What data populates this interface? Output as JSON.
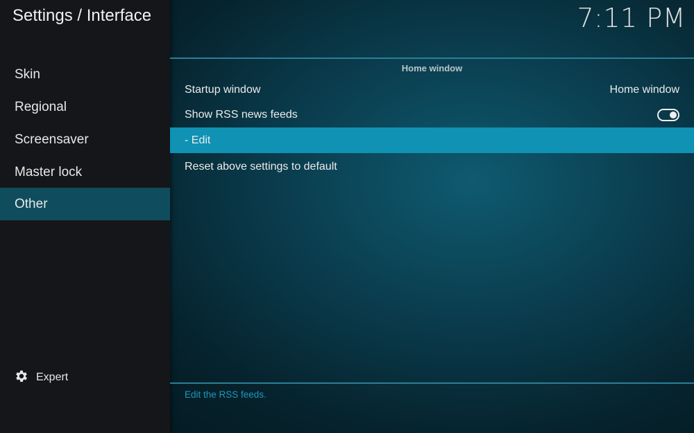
{
  "header": {
    "title": "Settings / Interface"
  },
  "clock": "7:11 PM",
  "sidebar": {
    "items": [
      {
        "label": "Skin"
      },
      {
        "label": "Regional"
      },
      {
        "label": "Screensaver"
      },
      {
        "label": "Master lock"
      },
      {
        "label": "Other",
        "selected": true
      }
    ],
    "expert": {
      "label": "Expert",
      "icon": "gear-icon"
    }
  },
  "section": {
    "title": "Home window",
    "settings": [
      {
        "label": "Startup window",
        "value": "Home window"
      },
      {
        "label": "Show RSS news feeds",
        "toggle": "on"
      },
      {
        "label": "- Edit",
        "focused": true
      },
      {
        "label": "Reset above settings to default"
      }
    ]
  },
  "hint": "Edit the RSS feeds.",
  "colors": {
    "accent": "#0f92b4",
    "selected_category": "#0f4d5e",
    "sidebar_bg": "#141619",
    "hint_text": "#1f97c0"
  }
}
